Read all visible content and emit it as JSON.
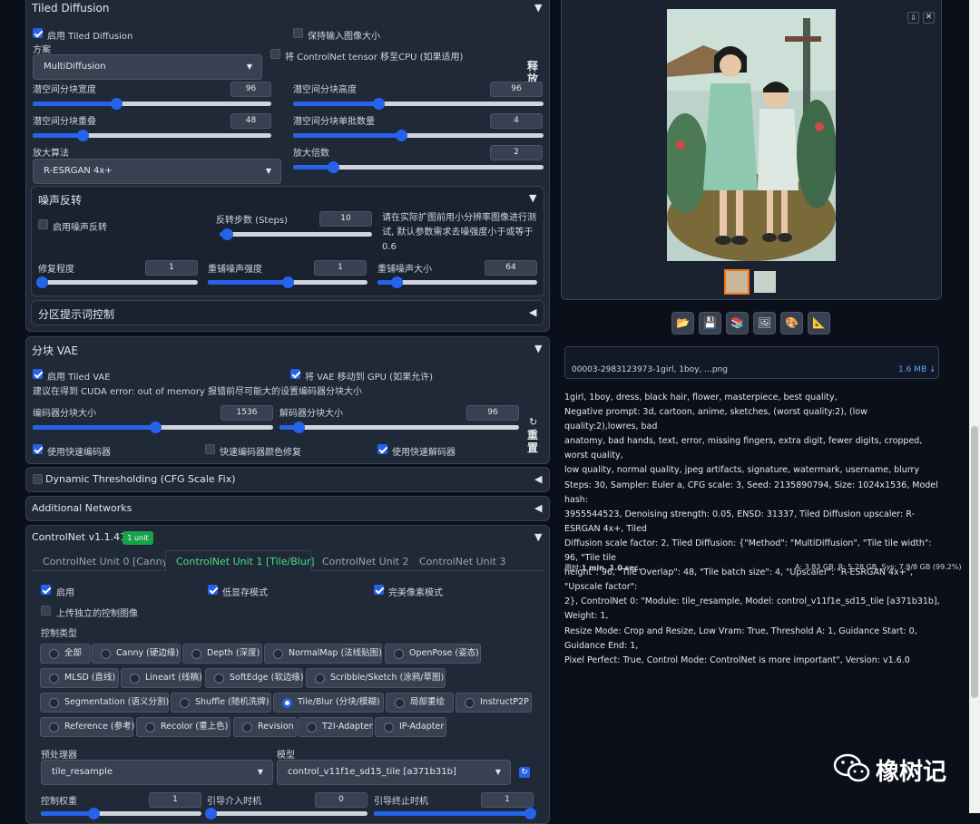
{
  "tiled_diffusion": {
    "title": "Tiled Diffusion",
    "enable": "启用 Tiled Diffusion",
    "keep_size": "保持输入图像大小",
    "method_label": "方案",
    "method": "MultiDiffusion",
    "move_cpu": "将 ControlNet tensor 移至CPU (如果适用)",
    "release": "释放",
    "latent_w": "潜空间分块宽度",
    "latent_w_val": "96",
    "latent_h": "潜空间分块高度",
    "latent_h_val": "96",
    "overlap": "潜空间分块重叠",
    "overlap_val": "48",
    "batch": "潜空间分块单批数量",
    "batch_val": "4",
    "upscaler_label": "放大算法",
    "upscaler": "R-ESRGAN 4x+",
    "scale": "放大倍数",
    "scale_val": "2",
    "noise": {
      "title": "噪声反转",
      "enable": "启用噪声反转",
      "steps": "反转步数 (Steps)",
      "steps_val": "10",
      "hint": "请在实际扩图前用小分辨率图像进行测试, 默认参数需求去噪强度小于或等于0.6",
      "retouch": "修复程度",
      "retouch_val": "1",
      "renoise_strength": "重铺噪声强度",
      "renoise_strength_val": "1",
      "renoise_size": "重铺噪声大小",
      "renoise_size_val": "64"
    },
    "region_prompt": "分区提示词控制"
  },
  "tiled_vae": {
    "title": "分块 VAE",
    "enable": "启用 Tiled VAE",
    "move_gpu": "将 VAE 移动到 GPU (如果允许)",
    "hint": "建议在得到 CUDA error: out of memory 报错前尽可能大的设置编码器分块大小",
    "enc_size": "编码器分块大小",
    "enc_size_val": "1536",
    "dec_size": "解码器分块大小",
    "dec_size_val": "96",
    "fast_enc": "使用快速编码器",
    "color_fix": "快速编码器颜色修复",
    "fast_dec": "使用快速解码器",
    "reset": "重置"
  },
  "dynamic_thresholding": "Dynamic Thresholding (CFG Scale Fix)",
  "additional_networks": "Additional Networks",
  "controlnet": {
    "title": "ControlNet v1.1.410",
    "badge": "1 unit",
    "tabs": [
      "ControlNet Unit 0 [Canny]",
      "ControlNet Unit 1 [Tile/Blur]",
      "ControlNet Unit 2",
      "ControlNet Unit 3"
    ],
    "enable": "启用",
    "low_vram": "低显存模式",
    "pixel_perfect": "完美像素模式",
    "upload_ind": "上传独立的控制图像",
    "control_type": "控制类型",
    "types_row1": [
      "全部",
      "Canny (硬边缘)",
      "Depth (深度)",
      "NormalMap (法线贴图)",
      "OpenPose (姿态)"
    ],
    "types_row2": [
      "MLSD (直线)",
      "Lineart (线稿)",
      "SoftEdge (软边缘)",
      "Scribble/Sketch (涂鸦/草图)"
    ],
    "types_row3": [
      "Segmentation (语义分割)",
      "Shuffle (随机洗牌)",
      "Tile/Blur (分块/模糊)",
      "局部重绘",
      "InstructP2P"
    ],
    "types_row4": [
      "Reference (参考)",
      "Recolor (重上色)",
      "Revision",
      "T2I-Adapter",
      "IP-Adapter"
    ],
    "preprocessor_label": "预处理器",
    "preprocessor": "tile_resample",
    "model_label": "模型",
    "model": "control_v11f1e_sd15_tile [a371b31b]",
    "weight": "控制权重",
    "weight_val": "1",
    "start": "引导介入时机",
    "start_val": "0",
    "end": "引导终止时机",
    "end_val": "1"
  },
  "output": {
    "filename": "00003-2983123973-1girl, 1boy, ...png",
    "filesize": "1.6 MB ↓",
    "info_lines": [
      "1girl, 1boy, dress, black hair, flower, masterpiece, best quality,",
      "Negative prompt: 3d, cartoon, anime, sketches, (worst quality:2), (low quality:2),lowres, bad",
      "anatomy, bad hands, text, error, missing fingers, extra digit, fewer digits, cropped, worst quality,",
      "low quality, normal quality, jpeg artifacts, signature, watermark, username, blurry",
      "Steps: 30, Sampler: Euler a, CFG scale: 3, Seed: 2135890794, Size: 1024x1536, Model hash:",
      "3955544523, Denoising strength: 0.05, ENSD: 31337, Tiled Diffusion upscaler: R-ESRGAN 4x+, Tiled",
      "Diffusion scale factor: 2, Tiled Diffusion: {\"Method\": \"MultiDiffusion\", \"Tile tile width\": 96, \"Tile tile",
      "height\": 96, \"Tile Overlap\": 48, \"Tile batch size\": 4, \"Upscaler\": \"R-ESRGAN 4x+\", \"Upscale factor\":",
      "2}, ControlNet 0: \"Module: tile_resample, Model: control_v11f1e_sd15_tile [a371b31b], Weight: 1,",
      "Resize Mode: Crop and Resize, Low Vram: True, Threshold A: 1, Guidance Start: 0, Guidance End: 1,",
      "Pixel Perfect: True, Control Mode: ControlNet is more important\", Version: v1.6.0"
    ],
    "time_label": "用时:",
    "time": "1 min. 1.0 sec.",
    "vram": "A: 3.83 GB, R: 5.28 GB, Sys: 7.9/8 GB (99.2%)"
  },
  "watermark": "橡树记",
  "icons": [
    "folder-icon",
    "save-icon",
    "zip-icon",
    "image-icon",
    "palette-icon",
    "ruler-icon",
    "download-icon",
    "close-icon",
    "refresh-icon",
    "wechat-icon"
  ],
  "colors": {
    "accent": "#2563eb",
    "active_tab": "#4ade80",
    "badge": "#16a34a",
    "background": "#0b0f19",
    "panel": "#1f2937"
  }
}
